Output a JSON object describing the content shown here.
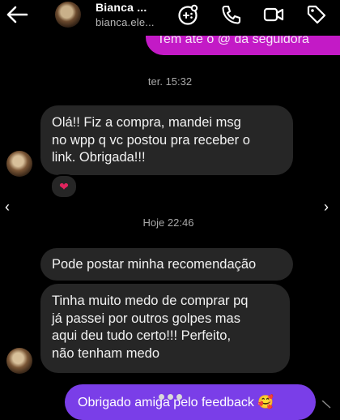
{
  "header": {
    "name": "Bianca ...",
    "username": "bianca.ele..."
  },
  "messages": {
    "top_sent": "Tem até o @ da seguidora",
    "time1": "ter. 15:32",
    "msg1_lines": [
      "Olá!! Fiz a compra, mandei msg",
      "no wpp q vc postou pra receber o",
      "link. Obrigada!!!"
    ],
    "reaction": "❤",
    "time2": "Hoje 22:46",
    "msg2": "Pode postar minha recomendação",
    "msg3_lines": [
      "Tinha muito medo de comprar pq",
      "já passei por outros golpes mas",
      "aqui deu tudo certo!!! Perfeito,",
      "não tenham medo"
    ],
    "sent_reply": "Obrigado amiga pelo feedback 🥰"
  },
  "colors": {
    "sent_magenta": "#c31ac6",
    "sent_purple": "#7a3ee8",
    "received_bg": "#262626"
  }
}
